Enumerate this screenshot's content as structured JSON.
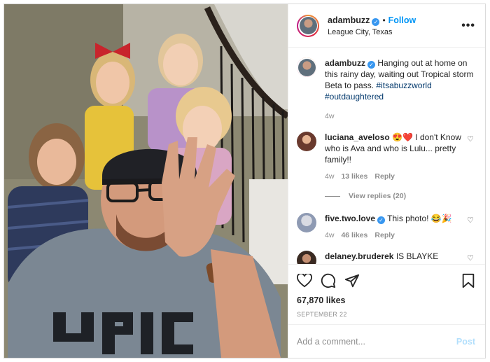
{
  "post": {
    "username": "adambuzz",
    "follow_label": "Follow",
    "location": "League City, Texas",
    "more_label": "•••"
  },
  "caption": {
    "username": "adambuzz",
    "text": " Hanging out at home on this rainy day, waiting out Tropical storm Beta to pass. ",
    "tag1": "#itsabuzzworld",
    "tag2": "#outdaughtered",
    "time": "4w"
  },
  "comments": [
    {
      "username": "luciana_aveloso",
      "text": " 😍❤️ I don't Know who is Ava and who is Lulu... pretty family!!",
      "time": "4w",
      "likes": "13 likes",
      "reply": "Reply",
      "view_replies": "View replies (20)"
    },
    {
      "username": "five.two.love",
      "text": " This photo! 😂🎉",
      "time": "4w",
      "likes": "46 likes",
      "reply": "Reply"
    },
    {
      "username": "delaney.bruderek",
      "text": " IS BLAYKE"
    }
  ],
  "footer": {
    "likes": "67,870 likes",
    "date": "SEPTEMBER 22",
    "comment_placeholder": "Add a comment...",
    "post_label": "Post"
  },
  "photo_logo": "UPIC"
}
